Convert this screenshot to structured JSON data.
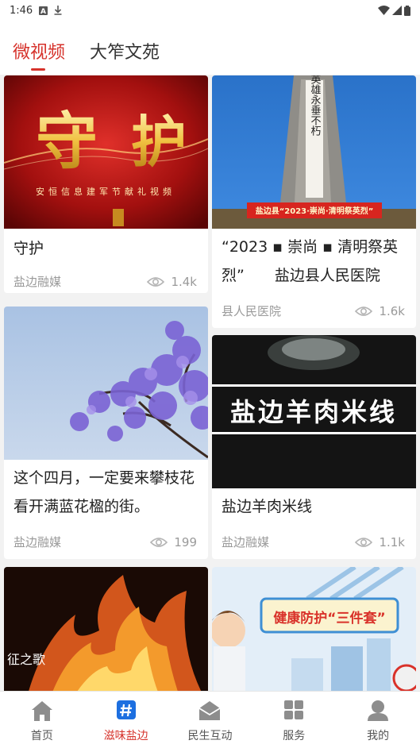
{
  "status": {
    "time": "1:46"
  },
  "tabs": [
    {
      "label": "微视频",
      "active": true
    },
    {
      "label": "大笮文苑",
      "active": false
    }
  ],
  "cards": [
    {
      "title": "守护",
      "source": "盐边融媒",
      "views": "1.4k",
      "thumb_title": "守护",
      "thumb_caption": "安恒信息建军节献礼视频"
    },
    {
      "title": "“2023 ▪ 崇尚 ▪ 清明祭英烈”　　盐边县人民医院",
      "source": "县人民医院",
      "views": "1.6k",
      "thumb_banner": "盐边县“2023·崇尚·清明祭英烈”",
      "thumb_monument": "人民英雄永垂不朽"
    },
    {
      "title": "这个四月，一定要来攀枝花看开满蓝花楹的街。",
      "source": "盐边融媒",
      "views": "199"
    },
    {
      "title": "盐边羊肉米线",
      "source": "盐边融媒",
      "views": "1.1k",
      "thumb_title": "盐边羊肉米线"
    },
    {
      "thumb_caption": "征之歌"
    },
    {
      "thumb_title": "健康防护“三件套”"
    }
  ],
  "nav": [
    {
      "label": "首页",
      "icon": "home-icon",
      "active": false
    },
    {
      "label": "滋味盐边",
      "icon": "hashtag-icon",
      "active": true
    },
    {
      "label": "民生互动",
      "icon": "mail-icon",
      "active": false
    },
    {
      "label": "服务",
      "icon": "grid-icon",
      "active": false
    },
    {
      "label": "我的",
      "icon": "user-icon",
      "active": false
    }
  ],
  "colors": {
    "accent": "#d6322b",
    "background": "#f2f2f2"
  }
}
